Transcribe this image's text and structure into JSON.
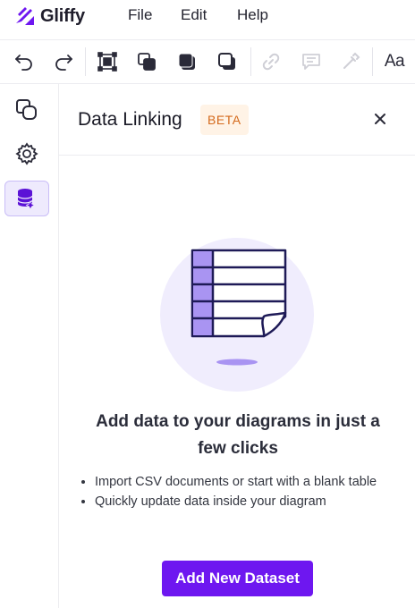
{
  "app": {
    "name": "Gliffy",
    "brand_color": "#6e17f0"
  },
  "menu": {
    "file": "File",
    "edit": "Edit",
    "help": "Help"
  },
  "toolbar": {
    "icons": [
      "undo-icon",
      "redo-icon",
      "group-icon",
      "arrange-icon",
      "bring-front-icon",
      "send-back-icon",
      "link-icon",
      "comment-icon",
      "eyedropper-icon"
    ],
    "font_label": "Aa"
  },
  "rail": {
    "items": [
      "shapes-icon",
      "settings-icon",
      "data-linking-icon"
    ],
    "active": "data-linking-icon"
  },
  "panel": {
    "title": "Data Linking",
    "badge": "BETA",
    "headline": "Add data to your diagrams in just a few clicks",
    "bullets": [
      "Import CSV documents or start with a blank table",
      "Quickly update data inside your diagram"
    ],
    "button_label": "Add New Dataset"
  }
}
